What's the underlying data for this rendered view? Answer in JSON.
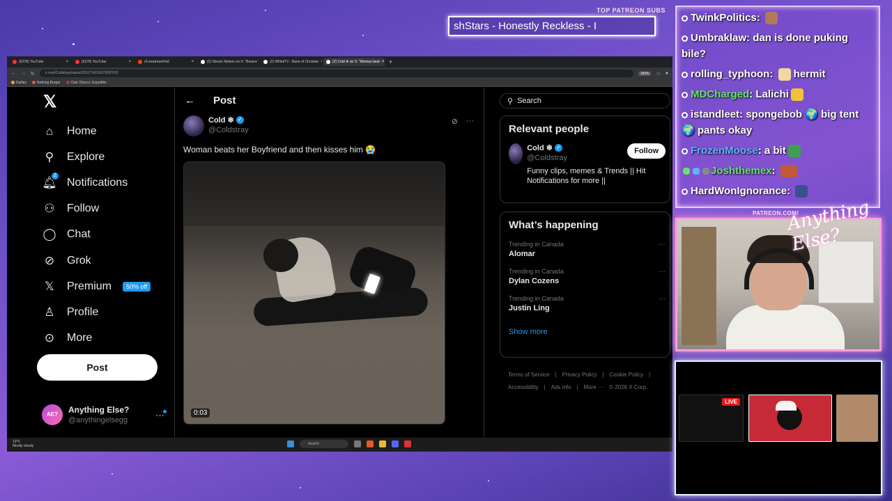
{
  "overlay": {
    "ticker_label": "TOP PATREON SUBS",
    "ticker_text": "shStars - Honestly Reckless - I",
    "patreon_url": "PATREON.COM/",
    "brand_script": "Anything Else?"
  },
  "browser": {
    "tabs": [
      {
        "label": "(6378) YouTube",
        "icon": "youtube-icon",
        "active": false
      },
      {
        "label": "(6378) YouTube",
        "icon": "youtube-icon",
        "active": false
      },
      {
        "label": "r/LivestreamFail",
        "icon": "reddit-icon",
        "active": false
      },
      {
        "label": "(2) Steven Nelson on X: \"Bizarre",
        "icon": "x-icon",
        "active": false
      },
      {
        "label": "(2) WNekTV - Bane of Christian",
        "icon": "x-icon",
        "active": false
      },
      {
        "label": "(2) Cold ❄ on X: \"Woman beat",
        "icon": "x-icon",
        "active": true
      }
    ],
    "url": "x.com/Coldstray/status/2016714191679037632",
    "zoom": "150%",
    "bookmarks": [
      "Dailies",
      "Nothing Burger",
      "Clair Obscur: Expeditio"
    ]
  },
  "x": {
    "nav": [
      {
        "label": "Home",
        "icon": "home-icon"
      },
      {
        "label": "Explore",
        "icon": "search-icon"
      },
      {
        "label": "Notifications",
        "icon": "bell-icon",
        "badge": "2"
      },
      {
        "label": "Follow",
        "icon": "follow-icon"
      },
      {
        "label": "Chat",
        "icon": "chat-icon"
      },
      {
        "label": "Grok",
        "icon": "grok-icon"
      },
      {
        "label": "Premium",
        "icon": "x-icon",
        "promo": "50% off"
      },
      {
        "label": "Profile",
        "icon": "profile-icon"
      },
      {
        "label": "More",
        "icon": "more-icon"
      }
    ],
    "post_button": "Post",
    "account": {
      "name": "Anything Else?",
      "handle": "@anythingelsegg",
      "avatar_text": "AE?"
    },
    "post": {
      "header": "Post",
      "author_name": "Cold ❄",
      "author_handle": "@Coldstray",
      "text": "Woman beats her Boyfriend and then kisses him 😭",
      "video_time": "0:03"
    },
    "search_placeholder": "Search",
    "relevant": {
      "title": "Relevant people",
      "name": "Cold ❄",
      "handle": "@Coldstray",
      "bio": "Funny clips, memes & Trends || Hit Notifications for more ||",
      "follow": "Follow"
    },
    "happening": {
      "title": "What’s happening",
      "trends": [
        {
          "meta": "Trending in Canada",
          "name": "Alomar"
        },
        {
          "meta": "Trending in Canada",
          "name": "Dylan Cozens"
        },
        {
          "meta": "Trending in Canada",
          "name": "Justin Ling"
        }
      ],
      "show_more": "Show more"
    },
    "footer": [
      "Terms of Service",
      "|",
      "Privacy Policy",
      "|",
      "Cookie Policy",
      "|",
      "Accessibility",
      "|",
      "Ads info",
      "|",
      "More ···",
      "© 2026 X Corp."
    ]
  },
  "taskbar": {
    "temp": "13°C",
    "weather": "Mostly cloudy",
    "search": "Search"
  },
  "chat": [
    {
      "user": "TwinkPolitics",
      "text": "",
      "color": "#ffffff",
      "emote": "#b07a5a"
    },
    {
      "user": "Umbraklaw",
      "text": "dan is done puking bile?",
      "color": "#ffffff",
      "emote": ""
    },
    {
      "user": "rolling_typhoon",
      "text": "hermit",
      "color": "#ffffff",
      "emote": "#f0d8a0"
    },
    {
      "user": "MDCharged",
      "text": "Lalichi",
      "color": "#63e36f",
      "emote": "#f3c13a"
    },
    {
      "user": "istandleet",
      "text": "spongebob 🌍 big tent 🌍 pants okay",
      "color": "#ffffff",
      "emote": ""
    },
    {
      "user": "FrozenMoose",
      "text": "a bit",
      "color": "#5fb2ff",
      "emote": "#3f9f4f"
    },
    {
      "user": "Joshthemex",
      "text": "",
      "color": "#63e36f",
      "emote": "#c25a3a"
    },
    {
      "user": "HardWonIgnorance",
      "text": "",
      "color": "#ffffff",
      "emote": "#3a4f8f"
    }
  ],
  "bottom_panel": {
    "live_badge": "LIVE"
  }
}
